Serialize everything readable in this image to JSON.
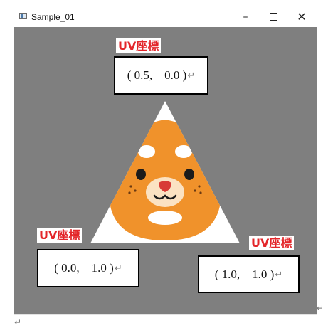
{
  "window": {
    "title": "Sample_01",
    "minimize_glyph": "–",
    "close_glyph": "✕"
  },
  "labels": {
    "top": {
      "tag": "UV座標",
      "coord": "( 0.5,    0.0 )"
    },
    "left": {
      "tag": "UV座標",
      "coord": "( 0.0,    1.0 )"
    },
    "right": {
      "tag": "UV座標",
      "coord": "( 1.0,    1.0 )"
    }
  },
  "return_mark": "↵",
  "colors": {
    "canvas": "#7f7f7f",
    "fur": "#f0922b",
    "tag_text": "#e3262a"
  }
}
